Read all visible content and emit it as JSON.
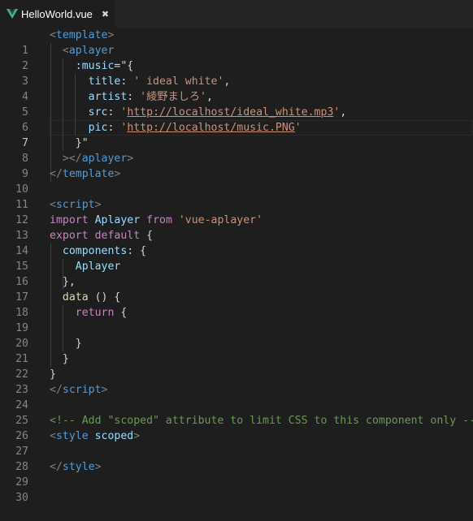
{
  "tab": {
    "label": "HelloWorld.vue",
    "close_glyph": "✖",
    "icon": "vue-icon"
  },
  "editor": {
    "active_line": 7,
    "line_numbers": [
      "1",
      "2",
      "3",
      "4",
      "5",
      "6",
      "7",
      "8",
      "9",
      "10",
      "11",
      "12",
      "13",
      "14",
      "15",
      "16",
      "17",
      "18",
      "19",
      "20",
      "21",
      "22",
      "23",
      "24",
      "25",
      "26",
      "27",
      "28",
      "29",
      "30"
    ],
    "tokens": {
      "l1": {
        "open": "<",
        "name": "template",
        "close": ">"
      },
      "l2": {
        "open": "<",
        "name": "aplayer"
      },
      "l3": {
        "attr": ":music",
        "eq": "=\"{"
      },
      "l4": {
        "key": "title",
        "colon": ": ",
        "str": "' ideal white'",
        "comma": ","
      },
      "l5": {
        "key": "artist",
        "colon": ": ",
        "str": "'綾野ましろ'",
        "comma": ","
      },
      "l6": {
        "key": "src",
        "colon": ": ",
        "q1": "'",
        "url": "http://localhost/ideal_white.mp3",
        "q2": "'",
        "comma": ","
      },
      "l7": {
        "key": "pic",
        "colon": ": ",
        "q1": "'",
        "url": "http://localhost/music.PNG",
        "q2": "'"
      },
      "l8": {
        "text": "}\""
      },
      "l9": {
        "open": "></",
        "name": "aplayer",
        "close": ">"
      },
      "l10": {
        "open": "</",
        "name": "template",
        "close": ">"
      },
      "l12": {
        "open": "<",
        "name": "script",
        "close": ">"
      },
      "l13": {
        "kw1": "import",
        "cls": "Aplayer",
        "kw2": "from",
        "str": "'vue-aplayer'"
      },
      "l14": {
        "kw1": "export",
        "kw2": "default",
        "brace": "{"
      },
      "l15": {
        "key": "components",
        "rest": ": {"
      },
      "l16": {
        "cls": "Aplayer"
      },
      "l17": {
        "text": "},"
      },
      "l18": {
        "fn": "data",
        "rest": " () {"
      },
      "l19": {
        "kw": "return",
        "rest": " {"
      },
      "l21": {
        "text": "}"
      },
      "l22": {
        "text": "}"
      },
      "l23": {
        "text": "}"
      },
      "l24": {
        "open": "</",
        "name": "script",
        "close": ">"
      },
      "l26": {
        "comment": "<!-- Add \"scoped\" attribute to limit CSS to this component only -->"
      },
      "l27": {
        "open": "<",
        "name": "style",
        "attr": "scoped",
        "close": ">"
      },
      "l29": {
        "open": "</",
        "name": "style",
        "close": ">"
      }
    }
  },
  "colors": {
    "background": "#1e1e1e",
    "tag": "#569cd6",
    "attribute": "#9cdcfe",
    "string": "#ce9178",
    "keyword": "#c586c0",
    "class": "#4ec9b0",
    "comment": "#6a9955",
    "vue_green": "#41b883"
  }
}
